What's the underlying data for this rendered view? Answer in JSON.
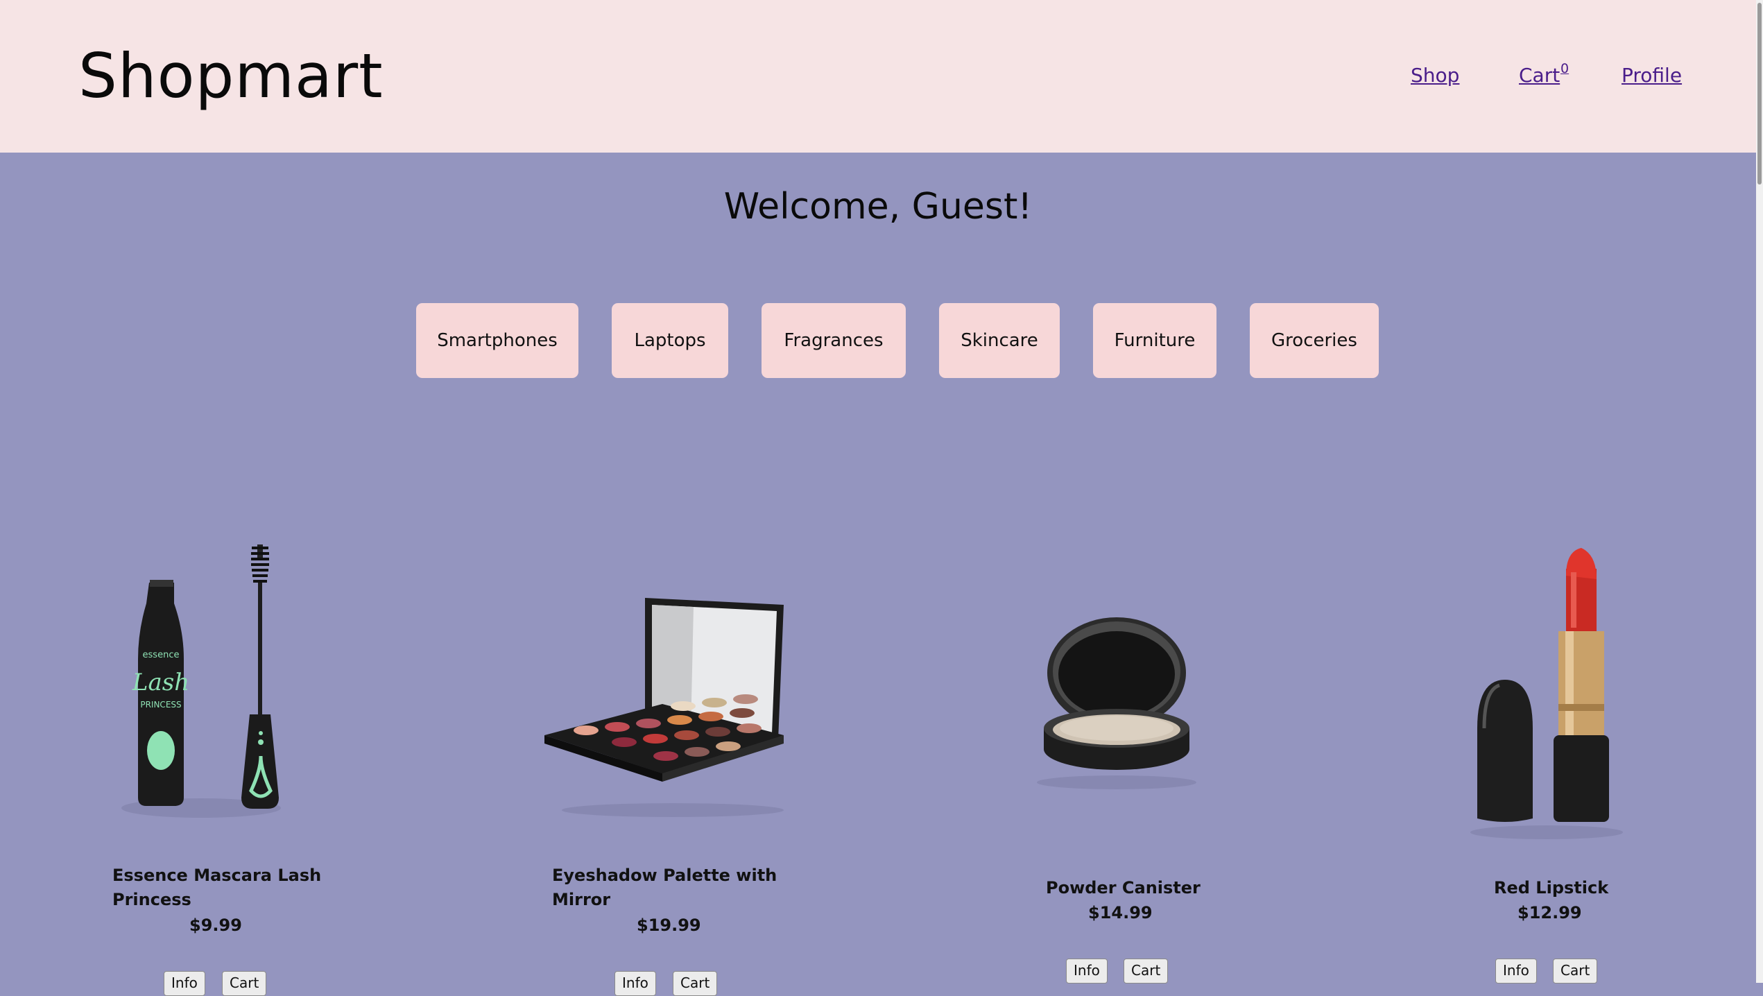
{
  "header": {
    "logo": "Shopmart",
    "nav": {
      "shop": "Shop",
      "cart": "Cart",
      "cart_count": "0",
      "profile": "Profile"
    }
  },
  "welcome": "Welcome, Guest!",
  "categories": [
    "Smartphones",
    "Laptops",
    "Fragrances",
    "Skincare",
    "Furniture",
    "Groceries"
  ],
  "products": [
    {
      "name_line1": "Essence Mascara Lash",
      "name_line2": "Princess",
      "price": "$9.99",
      "image": "mascara-image"
    },
    {
      "name_line1": "Eyeshadow Palette with",
      "name_line2": "Mirror",
      "price": "$19.99",
      "image": "eyeshadow-palette-image"
    },
    {
      "name_line1": "Powder Canister",
      "name_line2": "",
      "price": "$14.99",
      "image": "powder-canister-image"
    },
    {
      "name_line1": "Red Lipstick",
      "name_line2": "",
      "price": "$12.99",
      "image": "lipstick-image"
    }
  ],
  "buttons": {
    "info": "Info",
    "cart": "Cart"
  },
  "colors": {
    "header_bg": "#f6e4e5",
    "page_bg": "#9495bf",
    "category_bg": "#f7d7d8",
    "link": "#4a1d8a"
  }
}
